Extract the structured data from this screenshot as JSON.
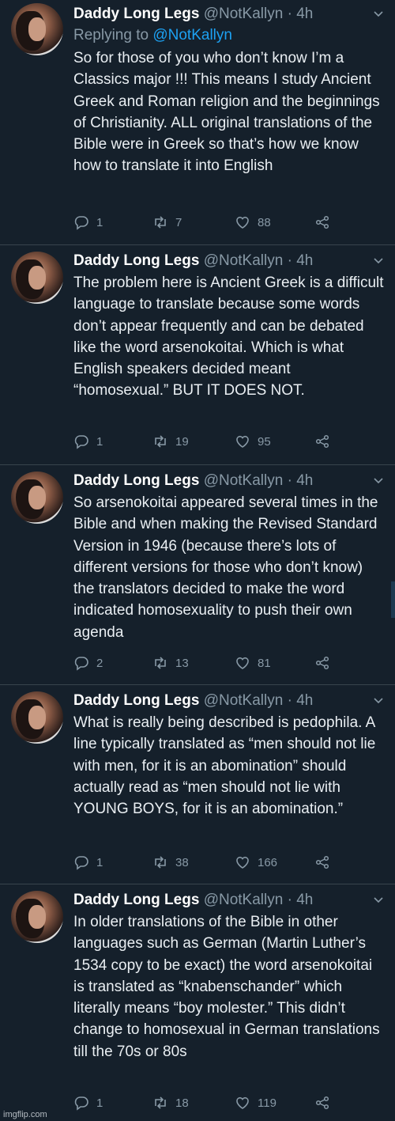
{
  "tweets": [
    {
      "name": "Daddy Long Legs",
      "handle": "@NotKallyn",
      "time": "4h",
      "reply_prefix": "Replying to",
      "reply_to": "@NotKallyn",
      "text": "So for those of you who don’t know I’m a Classics major !!! This means I study Ancient Greek and Roman religion and the beginnings of Christianity. ALL original translations of the Bible were in Greek so that’s how we know how to translate it into English",
      "replies": "1",
      "retweets": "7",
      "likes": "88"
    },
    {
      "name": "Daddy Long Legs",
      "handle": "@NotKallyn",
      "time": "4h",
      "text": "The problem here is Ancient Greek is a difficult language to translate because some words don’t appear frequently and can be debated like the word arsenokoitai. Which is what English speakers decided meant “homosexual.” BUT IT DOES NOT.",
      "replies": "1",
      "retweets": "19",
      "likes": "95"
    },
    {
      "name": "Daddy Long Legs",
      "handle": "@NotKallyn",
      "time": "4h",
      "text": "So arsenokoitai appeared several times in the Bible and when making the Revised Standard Version in 1946 (because there’s lots of different versions for those who don’t know) the translators decided to make the word indicated homosexuality to push their own agenda",
      "replies": "2",
      "retweets": "13",
      "likes": "81"
    },
    {
      "name": "Daddy Long Legs",
      "handle": "@NotKallyn",
      "time": "4h",
      "text": "What is really being described is pedophila. A line typically translated as “men should not lie with men, for it is an abomination” should actually read as “men should not lie with YOUNG BOYS, for it is an abomination.”",
      "replies": "1",
      "retweets": "38",
      "likes": "166"
    },
    {
      "name": "Daddy Long Legs",
      "handle": "@NotKallyn",
      "time": "4h",
      "text": "In older translations of the Bible in other languages such as German (Martin Luther’s 1534 copy to be exact) the word arsenokoitai is translated as “knabenschander” which literally means “boy molester.” This didn’t change to homosexual in German translations till the 70s or 80s",
      "replies": "1",
      "retweets": "18",
      "likes": "119"
    }
  ],
  "separator": "·",
  "watermark": "imgflip.com",
  "colors": {
    "background": "#15202b",
    "accent": "#1da1f2",
    "muted": "#8899a6"
  },
  "icons": [
    "avatar",
    "chevron-down-icon",
    "reply-icon",
    "retweet-icon",
    "like-icon",
    "share-icon"
  ]
}
